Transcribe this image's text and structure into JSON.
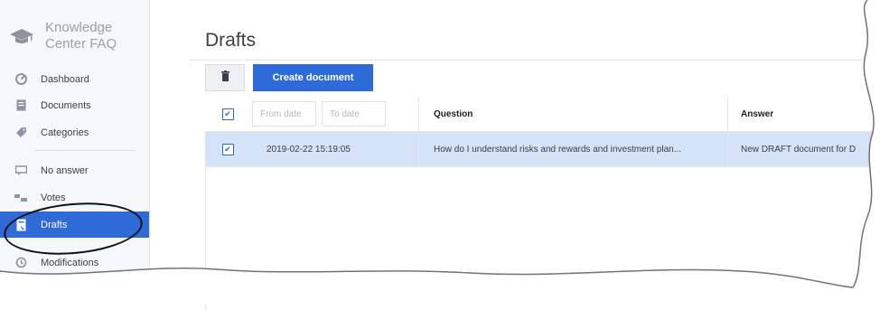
{
  "sidebar": {
    "brand": {
      "line1": "Knowledge",
      "line2": "Center FAQ",
      "icon": "graduation-cap-icon"
    },
    "items": [
      {
        "label": "Dashboard",
        "icon": "dashboard-icon"
      },
      {
        "label": "Documents",
        "icon": "document-icon"
      },
      {
        "label": "Categories",
        "icon": "tag-icon"
      },
      {
        "label": "No answer",
        "icon": "chat-icon"
      },
      {
        "label": "Votes",
        "icon": "votes-icon"
      },
      {
        "label": "Drafts",
        "icon": "draft-icon",
        "active": true
      },
      {
        "label": "Modifications",
        "icon": "history-icon"
      }
    ]
  },
  "main": {
    "title": "Drafts",
    "toolbar": {
      "delete_icon": "trash-icon",
      "create_label": "Create document"
    },
    "filters": {
      "from_placeholder": "From date",
      "to_placeholder": "To date"
    },
    "columns": {
      "question": "Question",
      "answer": "Answer"
    },
    "rows": [
      {
        "checked": true,
        "date": "2019-02-22 15:19:05",
        "question": "How do I understand risks and rewards and investment plan...",
        "answer": "New DRAFT document for D"
      }
    ]
  },
  "colors": {
    "accent": "#2f6bd8",
    "selected_row": "#d5e3f8",
    "sidebar_bg": "#f7f8fa"
  }
}
